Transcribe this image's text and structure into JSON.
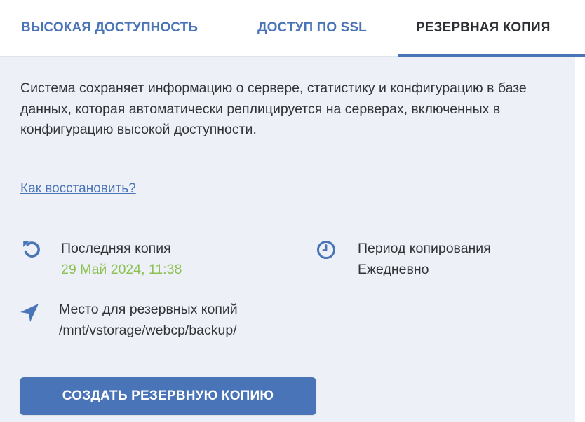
{
  "tabs": [
    {
      "label": "ВЫСОКАЯ ДОСТУПНОСТЬ",
      "active": false
    },
    {
      "label": "ДОСТУП ПО SSL",
      "active": false
    },
    {
      "label": "РЕЗЕРВНАЯ КОПИЯ",
      "active": true
    }
  ],
  "description": "Система сохраняет информацию о сервере, статистику и конфигурацию в базе данных, которая автоматически реплицируется на серверах, включенных в конфигурацию высокой доступности.",
  "help_link": "Как восстановить?",
  "last_backup": {
    "icon": "restore-icon",
    "label": "Последняя копия",
    "value": "29 Май 2024, 11:38"
  },
  "backup_period": {
    "icon": "clock-icon",
    "label": "Период копирования",
    "value": "Ежедневно"
  },
  "backup_location": {
    "icon": "location-arrow-icon",
    "label": "Место для резервных копий",
    "value": "/mnt/vstorage/webcp/backup/"
  },
  "create_button": "СОЗДАТЬ РЕЗЕРВНУЮ КОПИЮ",
  "colors": {
    "accent": "#4a74b8",
    "panel_bg": "#edf1f7",
    "success": "#8cc152",
    "text": "#2f3437"
  }
}
